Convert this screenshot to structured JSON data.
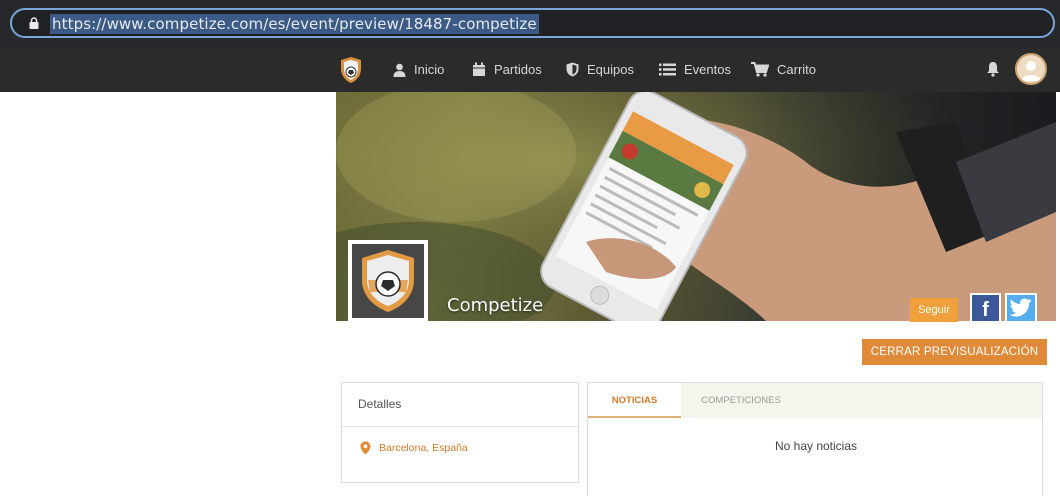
{
  "browser": {
    "url": "https://www.competize.com/es/event/preview/18487-competize"
  },
  "nav": {
    "items": [
      {
        "label": "Inicio",
        "icon": "user-icon"
      },
      {
        "label": "Partidos",
        "icon": "calendar-icon"
      },
      {
        "label": "Equipos",
        "icon": "shield-icon"
      },
      {
        "label": "Eventos",
        "icon": "list-icon"
      },
      {
        "label": "Carrito",
        "icon": "cart-icon"
      }
    ],
    "notifications_icon": "bell-icon",
    "avatar_icon": "avatar-icon"
  },
  "team": {
    "name": "Competize",
    "follow_label": "Seguir",
    "facebook_label": "f",
    "twitter_icon": "twitter-icon"
  },
  "actions": {
    "close_preview_label": "CERRAR PREVISUALIZACIÓN"
  },
  "details": {
    "title": "Detalles",
    "location": "Barcelona, España",
    "location_icon": "map-pin-icon"
  },
  "tabs": {
    "items": [
      "NOTICIAS",
      "COMPETICIONES"
    ],
    "active": "NOTICIAS",
    "empty_message": "No hay noticias"
  },
  "colors": {
    "accent": "#e08a38",
    "navbar": "#2b2b2b",
    "facebook": "#3b5998",
    "twitter": "#55acee"
  }
}
